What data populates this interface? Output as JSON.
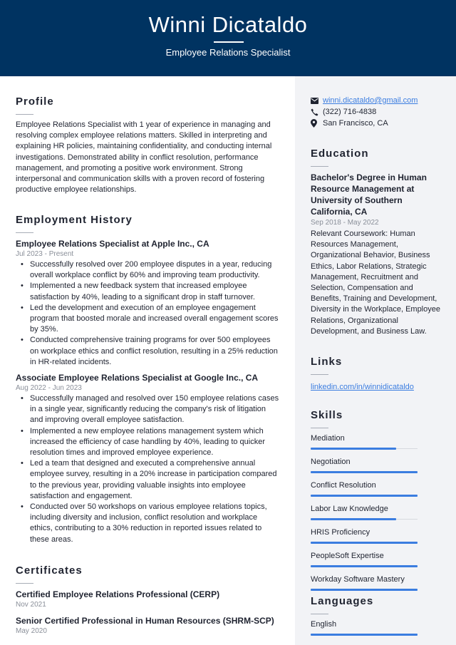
{
  "header": {
    "name": "Winni Dicataldo",
    "title": "Employee Relations Specialist",
    "background_color": "#003361"
  },
  "profile": {
    "heading": "Profile",
    "text": "Employee Relations Specialist with 1 year of experience in managing and resolving complex employee relations matters. Skilled in interpreting and explaining HR policies, maintaining confidentiality, and conducting internal investigations. Demonstrated ability in conflict resolution, performance management, and promoting a positive work environment. Strong interpersonal and communication skills with a proven record of fostering productive employee relationships."
  },
  "employment": {
    "heading": "Employment History",
    "jobs": [
      {
        "title": "Employee Relations Specialist at Apple Inc., CA",
        "dates": "Jul 2023 - Present",
        "bullets": [
          "Successfully resolved over 200 employee disputes in a year, reducing overall workplace conflict by 60% and improving team productivity.",
          "Implemented a new feedback system that increased employee satisfaction by 40%, leading to a significant drop in staff turnover.",
          "Led the development and execution of an employee engagement program that boosted morale and increased overall engagement scores by 35%.",
          "Conducted comprehensive training programs for over 500 employees on workplace ethics and conflict resolution, resulting in a 25% reduction in HR-related incidents."
        ]
      },
      {
        "title": "Associate Employee Relations Specialist at Google Inc., CA",
        "dates": "Aug 2022 - Jun 2023",
        "bullets": [
          "Successfully managed and resolved over 150 employee relations cases in a single year, significantly reducing the company's risk of litigation and improving overall employee satisfaction.",
          "Implemented a new employee relations management system which increased the efficiency of case handling by 40%, leading to quicker resolution times and improved employee experience.",
          "Led a team that designed and executed a comprehensive annual employee survey, resulting in a 20% increase in participation compared to the previous year, providing valuable insights into employee satisfaction and engagement.",
          "Conducted over 50 workshops on various employee relations topics, including diversity and inclusion, conflict resolution and workplace ethics, contributing to a 30% reduction in reported issues related to these areas."
        ]
      }
    ]
  },
  "certificates": {
    "heading": "Certificates",
    "items": [
      {
        "name": "Certified Employee Relations Professional (CERP)",
        "date": "Nov 2021"
      },
      {
        "name": "Senior Certified Professional in Human Resources (SHRM-SCP)",
        "date": "May 2020"
      }
    ]
  },
  "contact": {
    "email": "winni.dicataldo@gmail.com",
    "phone": "(322) 716-4838",
    "location": "San Francisco, CA",
    "icons": {
      "email": "envelope-icon",
      "phone": "phone-icon",
      "location": "map-pin-icon"
    }
  },
  "education": {
    "heading": "Education",
    "degree": "Bachelor's Degree in Human Resource Management at University of Southern California, CA",
    "dates": "Sep 2018 - May 2022",
    "description": "Relevant Coursework: Human Resources Management, Organizational Behavior, Business Ethics, Labor Relations, Strategic Management, Recruitment and Selection, Compensation and Benefits, Training and Development, Diversity in the Workplace, Employee Relations, Organizational Development, and Business Law."
  },
  "links": {
    "heading": "Links",
    "items": [
      {
        "label": "linkedin.com/in/winnidicataldo"
      }
    ]
  },
  "skills": {
    "heading": "Skills",
    "accent_color": "#3b7de0",
    "items": [
      {
        "label": "Mediation",
        "level": 0.8
      },
      {
        "label": "Negotiation",
        "level": 1.0
      },
      {
        "label": "Conflict Resolution",
        "level": 1.0
      },
      {
        "label": "Labor Law Knowledge",
        "level": 0.8
      },
      {
        "label": "HRIS Proficiency",
        "level": 1.0
      },
      {
        "label": "PeopleSoft Expertise",
        "level": 1.0
      },
      {
        "label": "Workday Software Mastery",
        "level": 1.0
      }
    ]
  },
  "languages": {
    "heading": "Languages",
    "items": [
      {
        "label": "English",
        "level": 1.0
      }
    ]
  }
}
